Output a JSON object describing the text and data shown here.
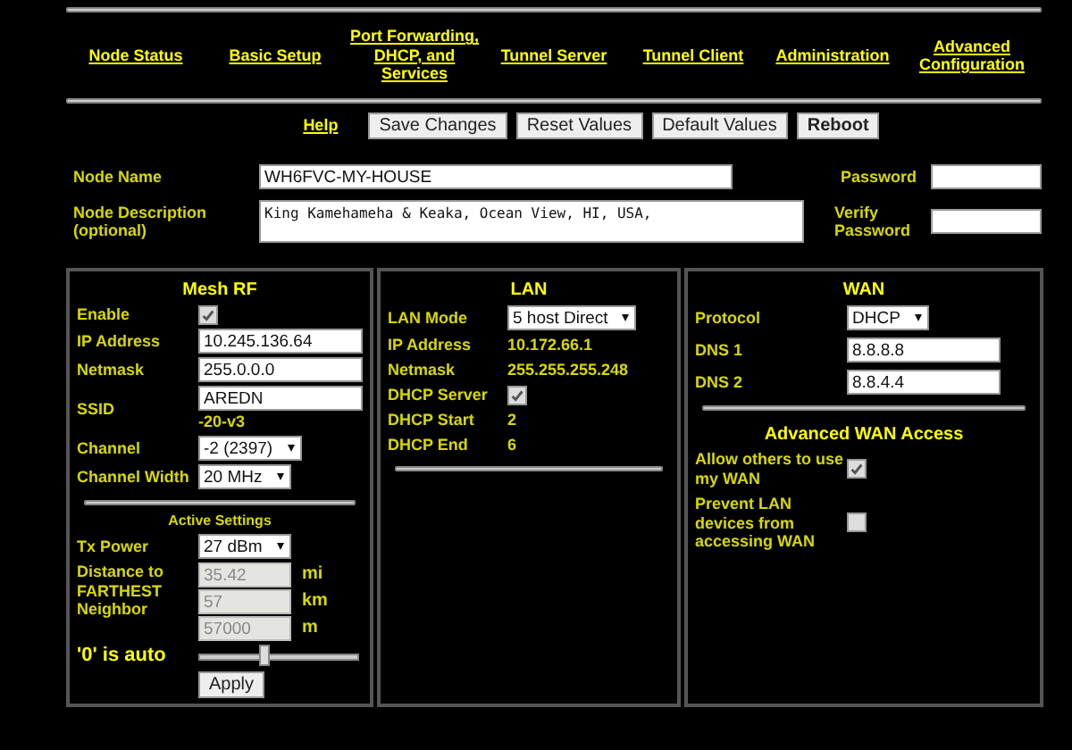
{
  "nav": [
    "Node Status",
    "Basic Setup",
    "Port Forwarding, DHCP, and Services",
    "Tunnel Server",
    "Tunnel Client",
    "Administration",
    "Advanced Configuration"
  ],
  "help": "Help",
  "buttons": [
    {
      "label": "Save Changes",
      "bold": false
    },
    {
      "label": "Reset Values",
      "bold": false
    },
    {
      "label": "Default Values",
      "bold": false
    },
    {
      "label": "Reboot",
      "bold": true
    }
  ],
  "node": {
    "name_label": "Node Name",
    "name_value": "WH6FVC-MY-HOUSE",
    "description_label": "Node Description (optional)",
    "description_value": "King Kamehameha & Keaka, Ocean View, HI, USA,",
    "password_label": "Password",
    "verify_label": "Verify Password"
  },
  "mesh_rf": {
    "title": "Mesh RF",
    "rows": [
      {
        "kind": "checkbox",
        "label": "Enable",
        "checked": true
      },
      {
        "kind": "input",
        "label": "IP Address",
        "value": "10.245.136.64"
      },
      {
        "kind": "input",
        "label": "Netmask",
        "value": "255.0.0.0"
      },
      {
        "kind": "ssid",
        "label": "SSID",
        "value": "AREDN",
        "suffix": "-20-v3"
      },
      {
        "kind": "select",
        "label": "Channel",
        "value": "-2 (2397)"
      },
      {
        "kind": "select",
        "label": "Channel Width",
        "value": "20 MHz"
      }
    ],
    "active_title": "Active Settings",
    "tx_power": {
      "label": "Tx Power",
      "value": "27 dBm"
    },
    "distance_label": "Distance to FARTHEST Neighbor",
    "distances": [
      {
        "value": "35.42",
        "unit": "mi"
      },
      {
        "value": "57",
        "unit": "km"
      },
      {
        "value": "57000",
        "unit": "m"
      }
    ],
    "auto_note": "'0' is auto",
    "slider": {
      "level": 0.38
    },
    "apply": "Apply"
  },
  "lan": {
    "title": "LAN",
    "rows": [
      {
        "kind": "select",
        "label": "LAN Mode",
        "value": "5 host Direct"
      },
      {
        "kind": "text",
        "label": "IP Address",
        "value": "10.172.66.1"
      },
      {
        "kind": "text",
        "label": "Netmask",
        "value": "255.255.255.248"
      },
      {
        "kind": "checkbox",
        "label": "DHCP Server",
        "checked": true
      },
      {
        "kind": "text",
        "label": "DHCP Start",
        "value": "2"
      },
      {
        "kind": "text",
        "label": "DHCP End",
        "value": "6"
      }
    ]
  },
  "wan": {
    "title": "WAN",
    "rows": [
      {
        "kind": "select",
        "label": "Protocol",
        "value": "DHCP"
      },
      {
        "kind": "input",
        "label": "DNS 1",
        "value": "8.8.8.8"
      },
      {
        "kind": "input",
        "label": "DNS 2",
        "value": "8.8.4.4"
      }
    ],
    "advanced_title": "Advanced WAN Access",
    "options": [
      {
        "label": "Allow others to use my WAN",
        "checked": true
      },
      {
        "label": "Prevent LAN devices from accessing WAN",
        "checked": false
      }
    ]
  }
}
